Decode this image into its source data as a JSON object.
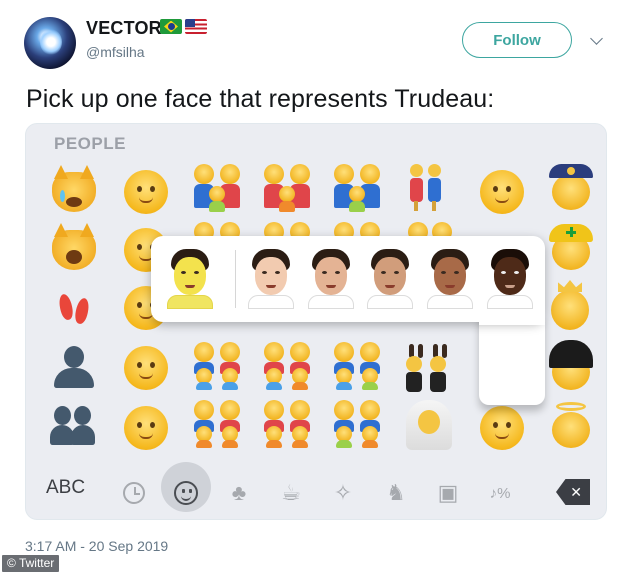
{
  "tweet": {
    "display_name": "VECTOR",
    "handle": "@mfsilha",
    "flags": [
      "brazil-flag",
      "usa-flag"
    ],
    "follow_label": "Follow",
    "text": "Pick up one face that represents Trudeau:",
    "timestamp": "3:17 AM - 20 Sep 2019"
  },
  "keyboard": {
    "category_label": "PEOPLE",
    "abc_label": "ABC",
    "delete_label": "✕",
    "selected_category": "smileys-people",
    "categories": [
      "recent-icon",
      "smiley-icon",
      "nature-icon",
      "food-icon",
      "celebration-icon",
      "activity-icon",
      "travel-icon",
      "symbols-icon"
    ],
    "skin_tone_options": [
      "yellow-default",
      "light",
      "medium-light",
      "medium",
      "medium-dark",
      "dark"
    ]
  },
  "credit": "© Twitter",
  "colors": {
    "follow_accent": "#3da6a0",
    "secondary_text": "#657786",
    "keyboard_bg": "#ebedf2"
  }
}
